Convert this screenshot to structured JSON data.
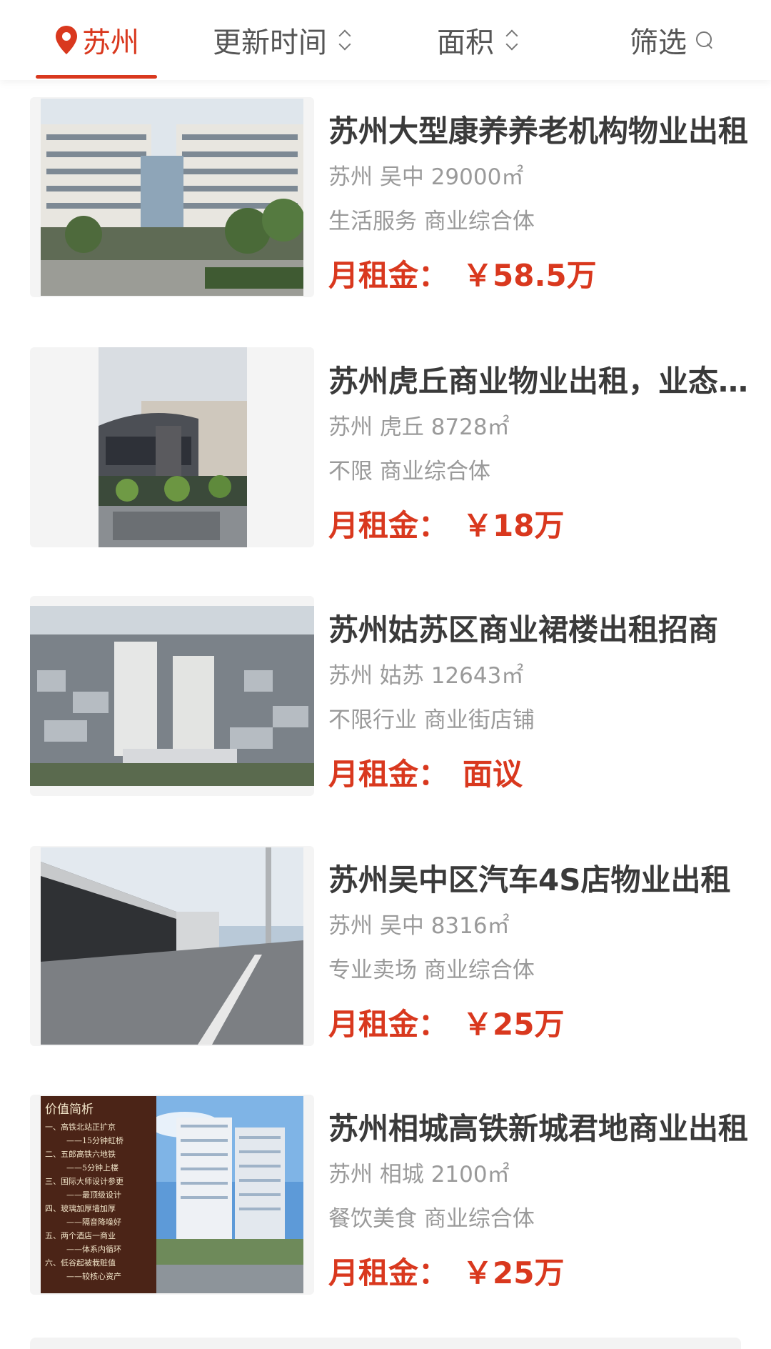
{
  "topbar": {
    "city": "苏州",
    "sort_update": "更新时间",
    "sort_area": "面积",
    "filter": "筛选",
    "accent": "#d9381e"
  },
  "listings": [
    {
      "title": "苏州大型康养养老机构物业出租",
      "location": "苏州 吴中 29000㎡",
      "category": "生活服务 商业综合体",
      "price_label": "月租金：",
      "price_value": "￥58.5万"
    },
    {
      "title": "苏州虎丘商业物业出租，业态不限",
      "location": "苏州 虎丘 8728㎡",
      "category": "不限 商业综合体",
      "price_label": "月租金：",
      "price_value": "￥18万"
    },
    {
      "title": "苏州姑苏区商业裙楼出租招商",
      "location": "苏州 姑苏 12643㎡",
      "category": "不限行业 商业街店铺",
      "price_label": "月租金：",
      "price_value": "面议"
    },
    {
      "title": "苏州吴中区汽车4S店物业出租",
      "location": "苏州 吴中 8316㎡",
      "category": "专业卖场 商业综合体",
      "price_label": "月租金：",
      "price_value": "￥25万"
    },
    {
      "title": "苏州相城高铁新城君地商业出租",
      "location": "苏州 相城 2100㎡",
      "category": "餐饮美食 商业综合体",
      "price_label": "月租金：",
      "price_value": "￥25万"
    }
  ],
  "promo_panel": {
    "heading": "价值简析",
    "lines": [
      "一、高铁北站正扩京",
      "——15分钟虹桥",
      "二、五郎高铁六地铁",
      "——5分钟上楼",
      "三、国际大师设计参更",
      "——最顶级设计",
      "四、玻璃加厚墙加厚",
      "——隔音降噪好",
      "五、两个酒店一商业",
      "——体系内循环",
      "六、低谷起被栽赃值",
      "——较核心资产"
    ]
  }
}
